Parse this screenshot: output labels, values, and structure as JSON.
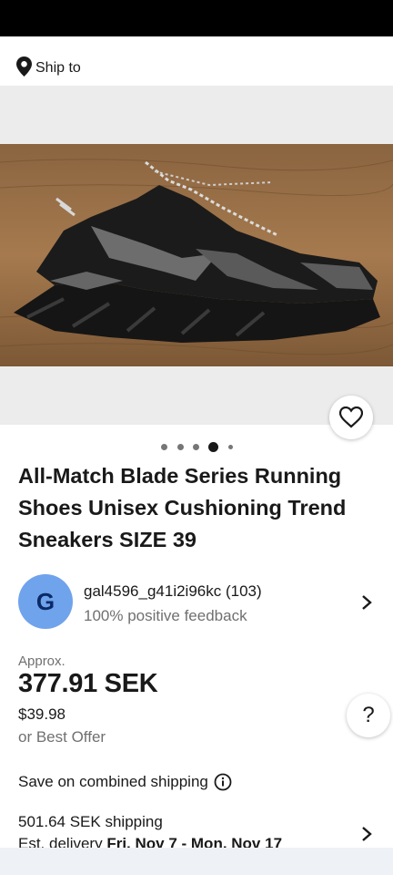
{
  "header": {
    "ship_to_label": "Ship to"
  },
  "gallery": {
    "image_count": 5,
    "active_index": 3
  },
  "listing": {
    "title_lines": [
      "All-Match Blade Series Running",
      "Shoes Unisex Cushioning Trend",
      "Sneakers SIZE 39"
    ]
  },
  "seller": {
    "avatar_letter": "G",
    "name_rating": "gal4596_g41i2i96kc (103)",
    "feedback": "100% positive feedback"
  },
  "price": {
    "approx_label": "Approx.",
    "amount": "377.91 SEK",
    "original": "$39.98",
    "best_offer": "or Best Offer",
    "help_glyph": "?"
  },
  "shipping": {
    "combined_label": "Save on combined shipping",
    "cost": "501.64 SEK shipping",
    "delivery_prefix": "Est. delivery",
    "delivery_dates": "Fri, Nov 7 - Mon, Nov 17"
  },
  "icons": [
    "location-pin-icon",
    "heart-icon",
    "chevron-right-icon",
    "help-icon",
    "info-icon"
  ],
  "colors": {
    "avatar_bg": "#6fa3ec",
    "muted_text": "#707070",
    "gallery_bg": "#ececec"
  }
}
